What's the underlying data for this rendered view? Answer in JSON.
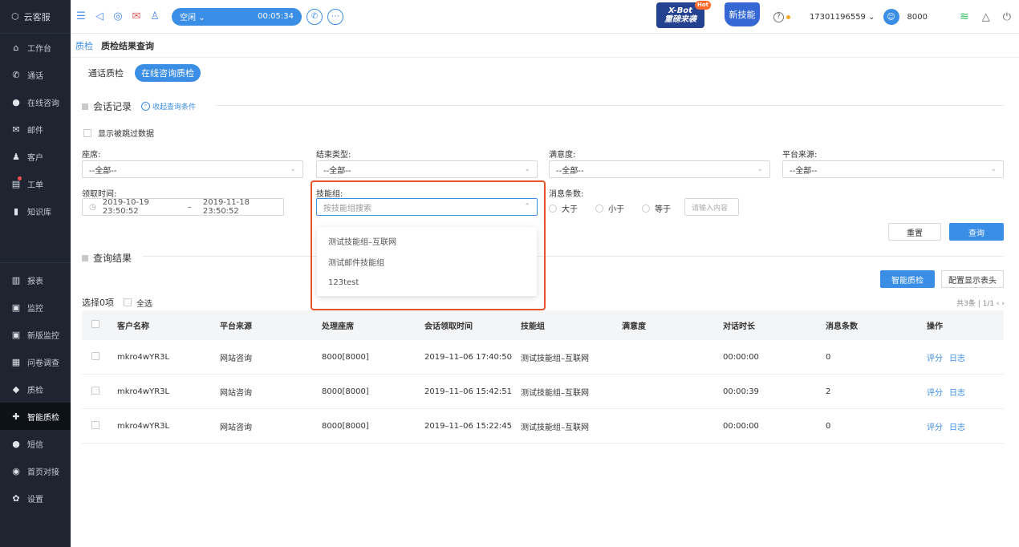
{
  "sidebar": {
    "brand": "云客服",
    "items": [
      {
        "icon": "home-icon",
        "glyph": "⌂",
        "label": "工作台"
      },
      {
        "icon": "phone-icon",
        "glyph": "✆",
        "label": "通话"
      },
      {
        "icon": "chat-icon",
        "glyph": "●",
        "label": "在线咨询"
      },
      {
        "icon": "mail-icon",
        "glyph": "✉",
        "label": "邮件"
      },
      {
        "icon": "user-icon",
        "glyph": "♟",
        "label": "客户"
      },
      {
        "icon": "ticket-icon",
        "glyph": "▤",
        "label": "工单"
      },
      {
        "icon": "book-icon",
        "glyph": "▮",
        "label": "知识库"
      }
    ],
    "items2": [
      {
        "icon": "report-icon",
        "glyph": "▥",
        "label": "报表"
      },
      {
        "icon": "monitor-icon",
        "glyph": "▣",
        "label": "监控"
      },
      {
        "icon": "new-monitor-icon",
        "glyph": "▣",
        "label": "新版监控"
      },
      {
        "icon": "survey-icon",
        "glyph": "▦",
        "label": "问卷调查"
      },
      {
        "icon": "shield-icon",
        "glyph": "◆",
        "label": "质检"
      },
      {
        "icon": "smart-qc-icon",
        "glyph": "✚",
        "label": "智能质检"
      },
      {
        "icon": "sms-icon",
        "glyph": "●",
        "label": "短信"
      },
      {
        "icon": "link-icon",
        "glyph": "◉",
        "label": "首页对接"
      },
      {
        "icon": "gear-icon",
        "glyph": "✿",
        "label": "设置"
      }
    ]
  },
  "topbar": {
    "status": "空闲",
    "timer": "00:05:34",
    "xbot_line1": "X-Bot",
    "xbot_line2": "重磅来袭",
    "xbot_badge": "Hot",
    "new_skill": "新技能",
    "account": "17301196559",
    "agent": "8000"
  },
  "breadcrumb": {
    "parent": "质检",
    "current": "质检结果查询"
  },
  "subtabs": {
    "call": "通话质检",
    "online": "在线咨询质检"
  },
  "filters": {
    "section_title": "会话记录",
    "collapse_label": "收起查询条件",
    "show_skipped": "显示被跳过数据",
    "agent_label": "座席:",
    "agent_value": "--全部--",
    "end_type_label": "结束类型:",
    "end_type_value": "--全部--",
    "satisfaction_label": "满意度:",
    "satisfaction_value": "--全部--",
    "platform_label": "平台来源:",
    "platform_value": "--全部--",
    "time_label": "领取时间:",
    "time_start": "2019-10-19 23:50:52",
    "time_sep": "–",
    "time_end": "2019-11-18 23:50:52",
    "skill_label": "技能组:",
    "skill_placeholder": "按技能组搜索",
    "msg_count_label": "消息条数:",
    "gt": "大于",
    "lt": "小于",
    "eq": "等于",
    "count_placeholder": "请输入内容",
    "reset": "重置",
    "query": "查询"
  },
  "skill_dropdown": [
    "测试技能组–互联网",
    "测试邮件技能组",
    "123test"
  ],
  "results": {
    "section_title": "查询结果",
    "smart_qc": "智能质检",
    "config_header": "配置显示表头",
    "selected": "选择0项",
    "select_all": "全选",
    "pager": "共3条 | 1/1 ‹ ›",
    "columns": [
      "客户名称",
      "平台来源",
      "处理座席",
      "会话领取时间",
      "技能组",
      "满意度",
      "对话时长",
      "消息条数",
      "操作"
    ],
    "rows": [
      {
        "customer": "mkro4wYR3L",
        "platform": "网站咨询",
        "agent": "8000[8000]",
        "time": "2019–11–06 17:40:50",
        "skill": "测试技能组–互联网",
        "satisfaction": "",
        "duration": "00:00:00",
        "count": "0"
      },
      {
        "customer": "mkro4wYR3L",
        "platform": "网站咨询",
        "agent": "8000[8000]",
        "time": "2019–11–06 15:42:51",
        "skill": "测试技能组–互联网",
        "satisfaction": "",
        "duration": "00:00:39",
        "count": "2"
      },
      {
        "customer": "mkro4wYR3L",
        "platform": "网站咨询",
        "agent": "8000[8000]",
        "time": "2019–11–06 15:22:45",
        "skill": "测试技能组–互联网",
        "satisfaction": "",
        "duration": "00:00:00",
        "count": "0"
      }
    ],
    "action_rate": "评分",
    "action_log": "日志"
  }
}
